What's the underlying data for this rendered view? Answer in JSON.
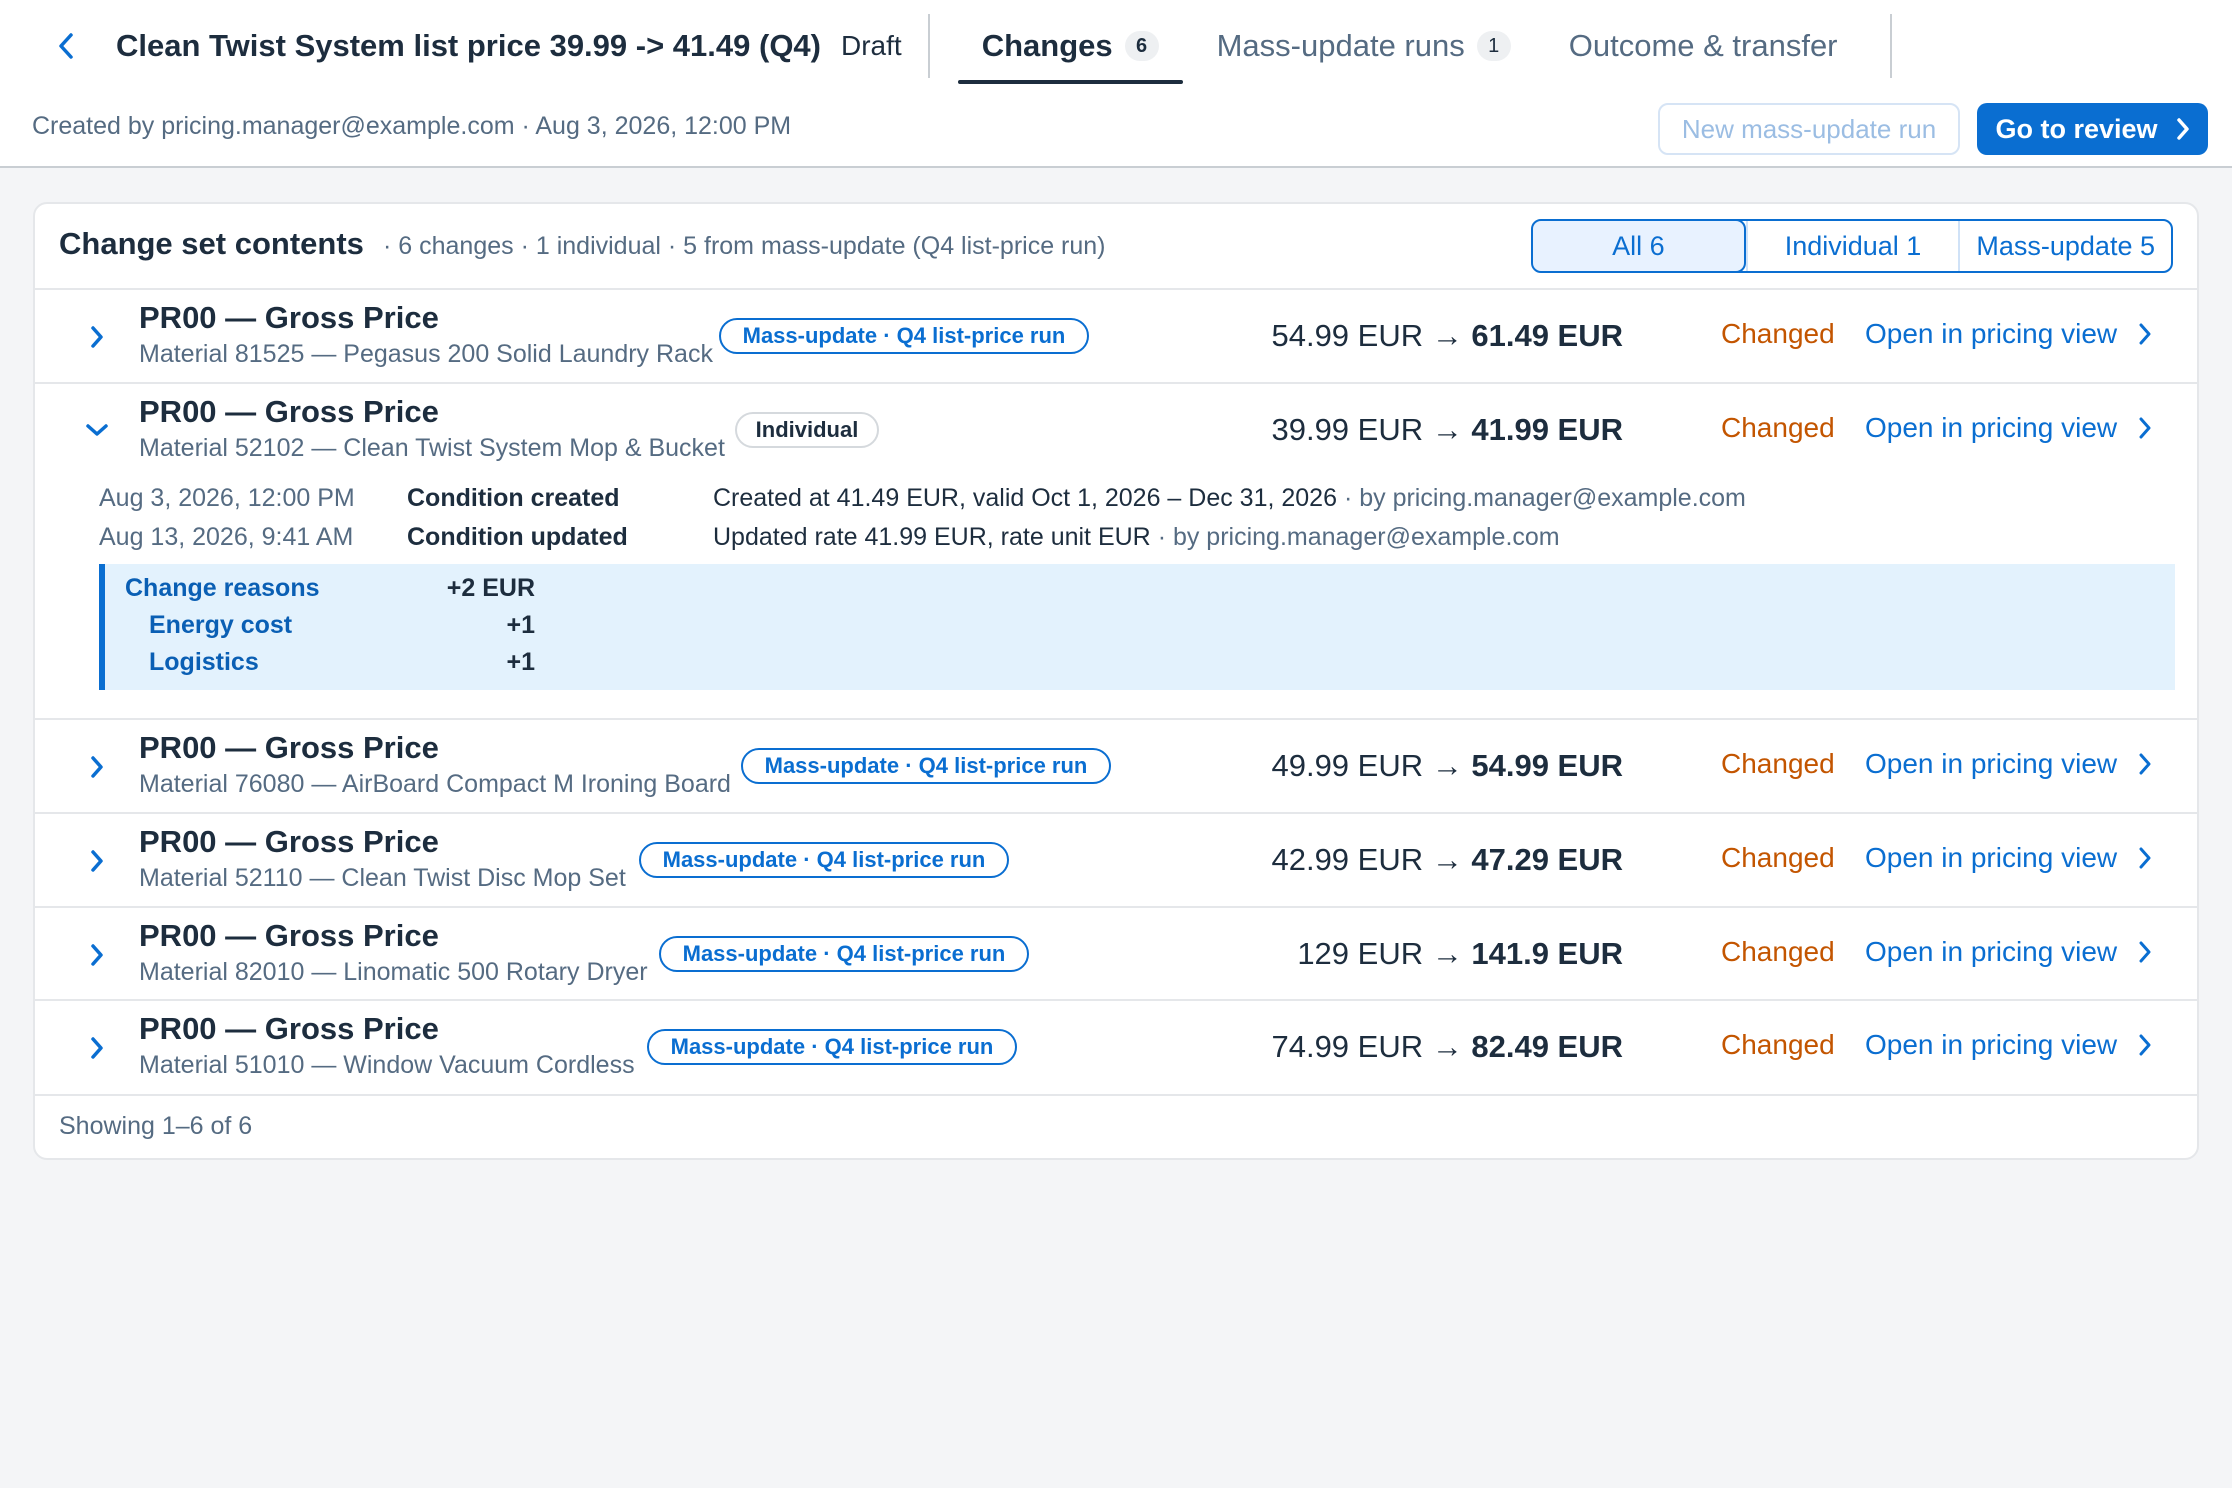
{
  "header": {
    "title": "Clean Twist System list price 39.99 -> 41.49 (Q4)",
    "status": "Draft",
    "tabs": [
      {
        "label": "Changes",
        "count": "6"
      },
      {
        "label": "Mass-update runs",
        "count": "1"
      },
      {
        "label": "Outcome & transfer",
        "count": ""
      }
    ],
    "meta": "Created by pricing.manager@example.com · Aug 3, 2026, 12:00 PM",
    "new_run_label": "New mass-update run",
    "review_label": "Go to review"
  },
  "card": {
    "title": "Change set contents",
    "summary": "· 6 changes · 1 individual · 5 from mass-update (Q4 list-price run)",
    "filters": [
      "All 6",
      "Individual 1",
      "Mass-update 5"
    ],
    "footer": "Showing 1–6 of 6"
  },
  "rows": [
    {
      "condition": "PR00 — Gross Price",
      "material": "Material 81525 — Pegasus 200 Solid Laundry Rack",
      "badge": "Mass-update · Q4 list-price run",
      "old": "54.99 EUR",
      "arrow": "→",
      "new": "61.49 EUR",
      "status": "Changed",
      "link": "Open in pricing view"
    },
    {
      "condition": "PR00 — Gross Price",
      "material": "Material 52102 — Clean Twist System Mop & Bucket",
      "badge": "Individual",
      "old": "39.99 EUR",
      "arrow": "→",
      "new": "41.99 EUR",
      "status": "Changed",
      "link": "Open in pricing view",
      "history": [
        {
          "time": "Aug 3, 2026, 12:00 PM",
          "event": "Condition created",
          "detail": "Created at 41.49 EUR, valid Oct 1, 2026 – Dec 31, 2026",
          "by": "· by pricing.manager@example.com"
        },
        {
          "time": "Aug 13, 2026, 9:41 AM",
          "event": "Condition updated",
          "detail": "Updated rate 41.99 EUR, rate unit EUR",
          "by": "· by pricing.manager@example.com"
        }
      ],
      "reasons": {
        "title": "Change reasons",
        "total": "+2 EUR",
        "items": [
          {
            "label": "Energy cost",
            "value": "+1"
          },
          {
            "label": "Logistics",
            "value": "+1"
          }
        ]
      }
    },
    {
      "condition": "PR00 — Gross Price",
      "material": "Material 76080 — AirBoard Compact M Ironing Board",
      "badge": "Mass-update · Q4 list-price run",
      "old": "49.99 EUR",
      "arrow": "→",
      "new": "54.99 EUR",
      "status": "Changed",
      "link": "Open in pricing view"
    },
    {
      "condition": "PR00 — Gross Price",
      "material": "Material 52110 — Clean Twist Disc Mop Set",
      "badge": "Mass-update · Q4 list-price run",
      "old": "42.99 EUR",
      "arrow": "→",
      "new": "47.29 EUR",
      "status": "Changed",
      "link": "Open in pricing view"
    },
    {
      "condition": "PR00 — Gross Price",
      "material": "Material 82010 — Linomatic 500 Rotary Dryer",
      "badge": "Mass-update · Q4 list-price run",
      "old": "129 EUR",
      "arrow": "→",
      "new": "141.9 EUR",
      "status": "Changed",
      "link": "Open in pricing view"
    },
    {
      "condition": "PR00 — Gross Price",
      "material": "Material 51010 — Window Vacuum Cordless",
      "badge": "Mass-update · Q4 list-price run",
      "old": "74.99 EUR",
      "arrow": "→",
      "new": "82.49 EUR",
      "status": "Changed",
      "link": "Open in pricing view"
    }
  ],
  "colors": {
    "accent": "#0a6ed1",
    "changed": "#c35500",
    "reasons_bg": "#e3f2fd"
  }
}
